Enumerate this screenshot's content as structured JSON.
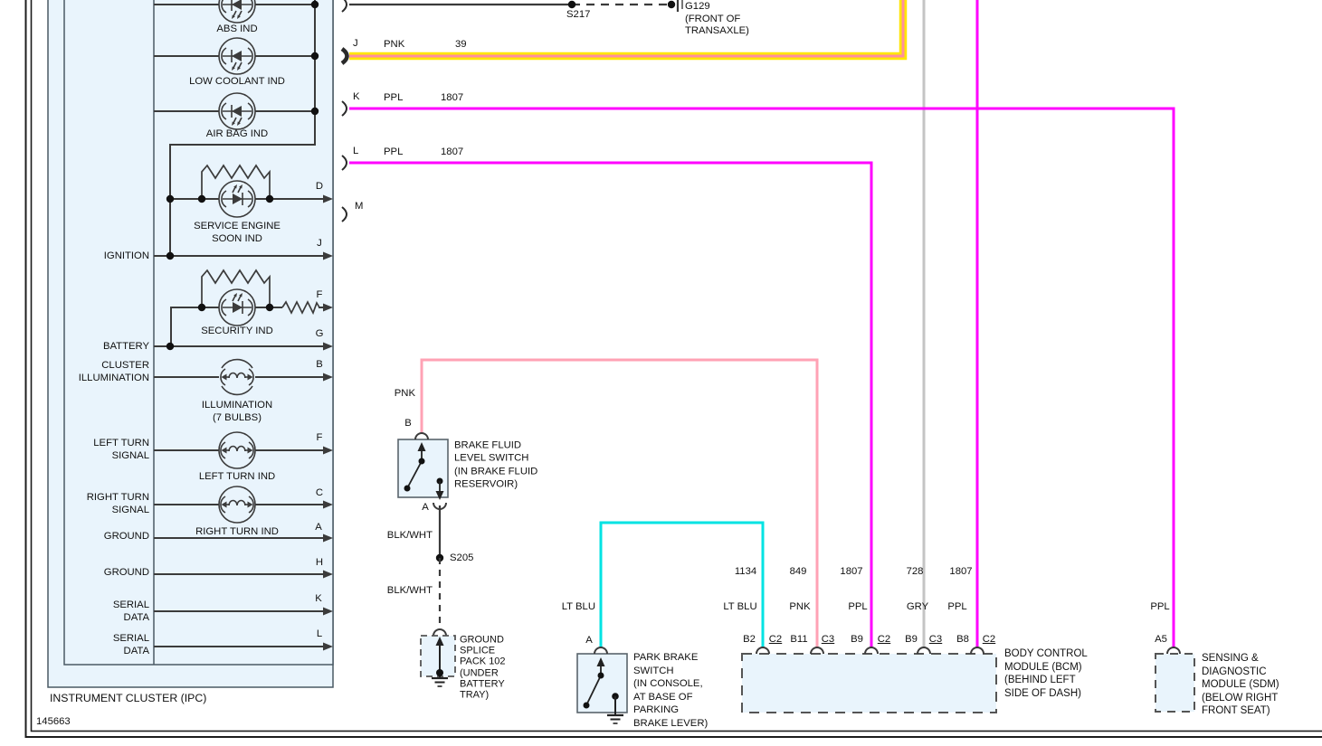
{
  "diagram": {
    "number": "145663"
  },
  "colors": {
    "wire_yellow": "#FFE600",
    "wire_pink_core": "#FF8F9F",
    "wire_ppl": "#FF00FF",
    "wire_pnk": "#FFA2B4",
    "wire_lt_blu": "#00E3E3",
    "wire_gry": "#C4C4C4",
    "circuit_line": "#3B3B3B",
    "module_fill": "#E9F4FC",
    "box_stroke": "#4A5A64"
  },
  "ipc": {
    "title": "INSTRUMENT CLUSTER (IPC)",
    "left_pins": [
      {
        "label": "IGNITION"
      },
      {
        "label": "BATTERY"
      },
      {
        "label": "CLUSTER\nILLUMINATION"
      },
      {
        "label": "LEFT TURN\nSIGNAL"
      },
      {
        "label": "RIGHT TURN\nSIGNAL"
      },
      {
        "label": "GROUND"
      },
      {
        "label": "GROUND"
      },
      {
        "label": "SERIAL\nDATA"
      },
      {
        "label": "SERIAL\nDATA"
      }
    ],
    "indicators": [
      {
        "label": "ABS IND"
      },
      {
        "label": "LOW COOLANT IND"
      },
      {
        "label": "AIR BAG IND"
      },
      {
        "label": "SERVICE ENGINE\nSOON IND"
      },
      {
        "label": "SECURITY IND"
      },
      {
        "label": "ILLUMINATION\n(7 BULBS)"
      },
      {
        "label": "LEFT TURN IND"
      },
      {
        "label": "RIGHT TURN IND"
      }
    ],
    "internal_pins": [
      "D",
      "J",
      "F",
      "G",
      "B",
      "F",
      "C",
      "A",
      "H",
      "K",
      "L"
    ],
    "connector": {
      "pins": [
        {
          "pin": "J",
          "wire_color": "PNK",
          "circuit": "39"
        },
        {
          "pin": "K",
          "wire_color": "PPL",
          "circuit": "1807"
        },
        {
          "pin": "L",
          "wire_color": "PPL",
          "circuit": "1807"
        },
        {
          "pin": "M",
          "wire_color": "",
          "circuit": ""
        }
      ]
    }
  },
  "top_ground_path": {
    "splice": "S217",
    "ground": "G129\n(FRONT OF\nTRANSAXLE)"
  },
  "brake_fluid_switch": {
    "wire_top_color": "PNK",
    "pin_top": "B",
    "label": "BRAKE FLUID\nLEVEL SWITCH\n(IN BRAKE FLUID\nRESERVOIR)",
    "pin_bottom": "A",
    "wire_bottom_color": "BLK/WHT",
    "splice": "S205",
    "wire_splice_color": "BLK/WHT"
  },
  "ground_splice_pack": {
    "label": "GROUND\nSPLICE\nPACK 102\n(UNDER\nBATTERY\nTRAY)"
  },
  "park_brake_switch": {
    "wire_color": "LT BLU",
    "pin": "A",
    "label": "PARK BRAKE\nSWITCH\n(IN CONSOLE,\nAT BASE OF\nPARKING\nBRAKE LEVER)"
  },
  "bcm": {
    "label": "BODY CONTROL\nMODULE (BCM)\n(BEHIND LEFT\nSIDE OF DASH)",
    "pins": [
      {
        "circuit": "1134",
        "wire_color": "LT BLU",
        "pin": "B2",
        "connector": "C2"
      },
      {
        "circuit": "849",
        "wire_color": "PNK",
        "pin": "B11",
        "connector": "C3"
      },
      {
        "circuit": "1807",
        "wire_color": "PPL",
        "pin": "B9",
        "connector": "C2"
      },
      {
        "circuit": "728",
        "wire_color": "GRY",
        "pin": "B9",
        "connector": "C3"
      },
      {
        "circuit": "1807",
        "wire_color": "PPL",
        "pin": "B8",
        "connector": "C2"
      }
    ]
  },
  "sdm": {
    "wire_color": "PPL",
    "pin": "A5",
    "label": "SENSING &\nDIAGNOSTIC\nMODULE (SDM)\n(BELOW RIGHT\nFRONT SEAT)"
  }
}
